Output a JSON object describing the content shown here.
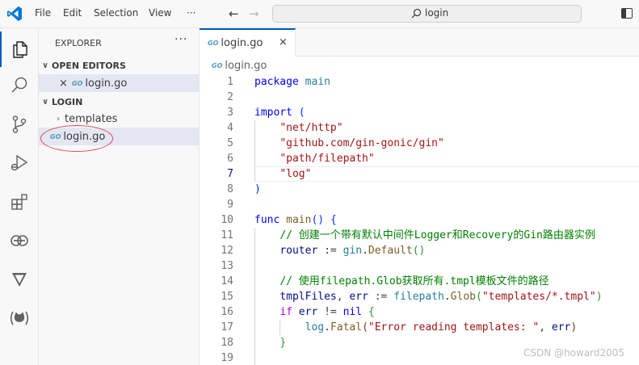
{
  "titlebar": {
    "menu": [
      "File",
      "Edit",
      "Selection",
      "View",
      "···"
    ],
    "search_text": "login"
  },
  "activity_icons": [
    "explorer-icon",
    "search-icon",
    "source-control-icon",
    "run-debug-icon",
    "extensions-icon",
    "remote-explorer-icon",
    "testing-icon",
    "github-icon"
  ],
  "sidebar": {
    "title": "EXPLORER",
    "more": "···",
    "open_editors_label": "OPEN EDITORS",
    "open_editor_file": "login.go",
    "project_label": "LOGIN",
    "folder_templates": "templates",
    "file_login": "login.go"
  },
  "editor": {
    "tab_label": "login.go",
    "breadcrumb": "login.go",
    "current_line": 7
  },
  "code_lines": [
    {
      "n": "1",
      "tokens": [
        [
          "kw",
          "package"
        ],
        [
          "pn",
          " "
        ],
        [
          "pkg",
          "main"
        ]
      ]
    },
    {
      "n": "2",
      "tokens": []
    },
    {
      "n": "3",
      "tokens": [
        [
          "kw",
          "import"
        ],
        [
          "pn",
          " "
        ],
        [
          "br1",
          "("
        ]
      ]
    },
    {
      "n": "4",
      "tokens": [
        [
          "pn",
          "    "
        ],
        [
          "str",
          "\"net/http\""
        ]
      ]
    },
    {
      "n": "5",
      "tokens": [
        [
          "pn",
          "    "
        ],
        [
          "str",
          "\"github.com/gin-gonic/gin\""
        ]
      ]
    },
    {
      "n": "6",
      "tokens": [
        [
          "pn",
          "    "
        ],
        [
          "str",
          "\"path/filepath\""
        ]
      ]
    },
    {
      "n": "7",
      "tokens": [
        [
          "pn",
          "    "
        ],
        [
          "str",
          "\"log\""
        ]
      ]
    },
    {
      "n": "8",
      "tokens": [
        [
          "br1",
          ")"
        ]
      ]
    },
    {
      "n": "9",
      "tokens": []
    },
    {
      "n": "10",
      "tokens": [
        [
          "kw",
          "func"
        ],
        [
          "pn",
          " "
        ],
        [
          "fn",
          "main"
        ],
        [
          "br1",
          "()"
        ],
        [
          "pn",
          " "
        ],
        [
          "br1",
          "{"
        ]
      ]
    },
    {
      "n": "11",
      "tokens": [
        [
          "pn",
          "    "
        ],
        [
          "cm",
          "// 创建一个带有默认中间件Logger和Recovery的Gin路由器实例"
        ]
      ]
    },
    {
      "n": "12",
      "tokens": [
        [
          "pn",
          "    "
        ],
        [
          "var",
          "router"
        ],
        [
          "pn",
          " := "
        ],
        [
          "pkg",
          "gin"
        ],
        [
          "pn",
          "."
        ],
        [
          "fn",
          "Default"
        ],
        [
          "br2",
          "()"
        ]
      ]
    },
    {
      "n": "13",
      "tokens": []
    },
    {
      "n": "14",
      "tokens": [
        [
          "pn",
          "    "
        ],
        [
          "cm",
          "// 使用filepath.Glob获取所有.tmpl模板文件的路径"
        ]
      ]
    },
    {
      "n": "15",
      "tokens": [
        [
          "pn",
          "    "
        ],
        [
          "var",
          "tmplFiles"
        ],
        [
          "pn",
          ", "
        ],
        [
          "var",
          "err"
        ],
        [
          "pn",
          " := "
        ],
        [
          "pkg",
          "filepath"
        ],
        [
          "pn",
          "."
        ],
        [
          "fn",
          "Glob"
        ],
        [
          "br2",
          "("
        ],
        [
          "str",
          "\"templates/*.tmpl\""
        ],
        [
          "br2",
          ")"
        ]
      ]
    },
    {
      "n": "16",
      "tokens": [
        [
          "pn",
          "    "
        ],
        [
          "kw2",
          "if"
        ],
        [
          "pn",
          " "
        ],
        [
          "var",
          "err"
        ],
        [
          "pn",
          " != "
        ],
        [
          "kw",
          "nil"
        ],
        [
          "pn",
          " "
        ],
        [
          "br2",
          "{"
        ]
      ]
    },
    {
      "n": "17",
      "tokens": [
        [
          "pn",
          "        "
        ],
        [
          "pkg",
          "log"
        ],
        [
          "pn",
          "."
        ],
        [
          "fn",
          "Fatal"
        ],
        [
          "br3",
          "("
        ],
        [
          "str",
          "\"Error reading templates: \""
        ],
        [
          "pn",
          ", "
        ],
        [
          "var",
          "err"
        ],
        [
          "br3",
          ")"
        ]
      ]
    },
    {
      "n": "18",
      "tokens": [
        [
          "pn",
          "    "
        ],
        [
          "br2",
          "}"
        ]
      ]
    },
    {
      "n": "19",
      "tokens": []
    }
  ],
  "watermark": "CSDN @howard2005",
  "colors": {
    "accent": "#005fb8",
    "annotation": "#e0485a"
  }
}
